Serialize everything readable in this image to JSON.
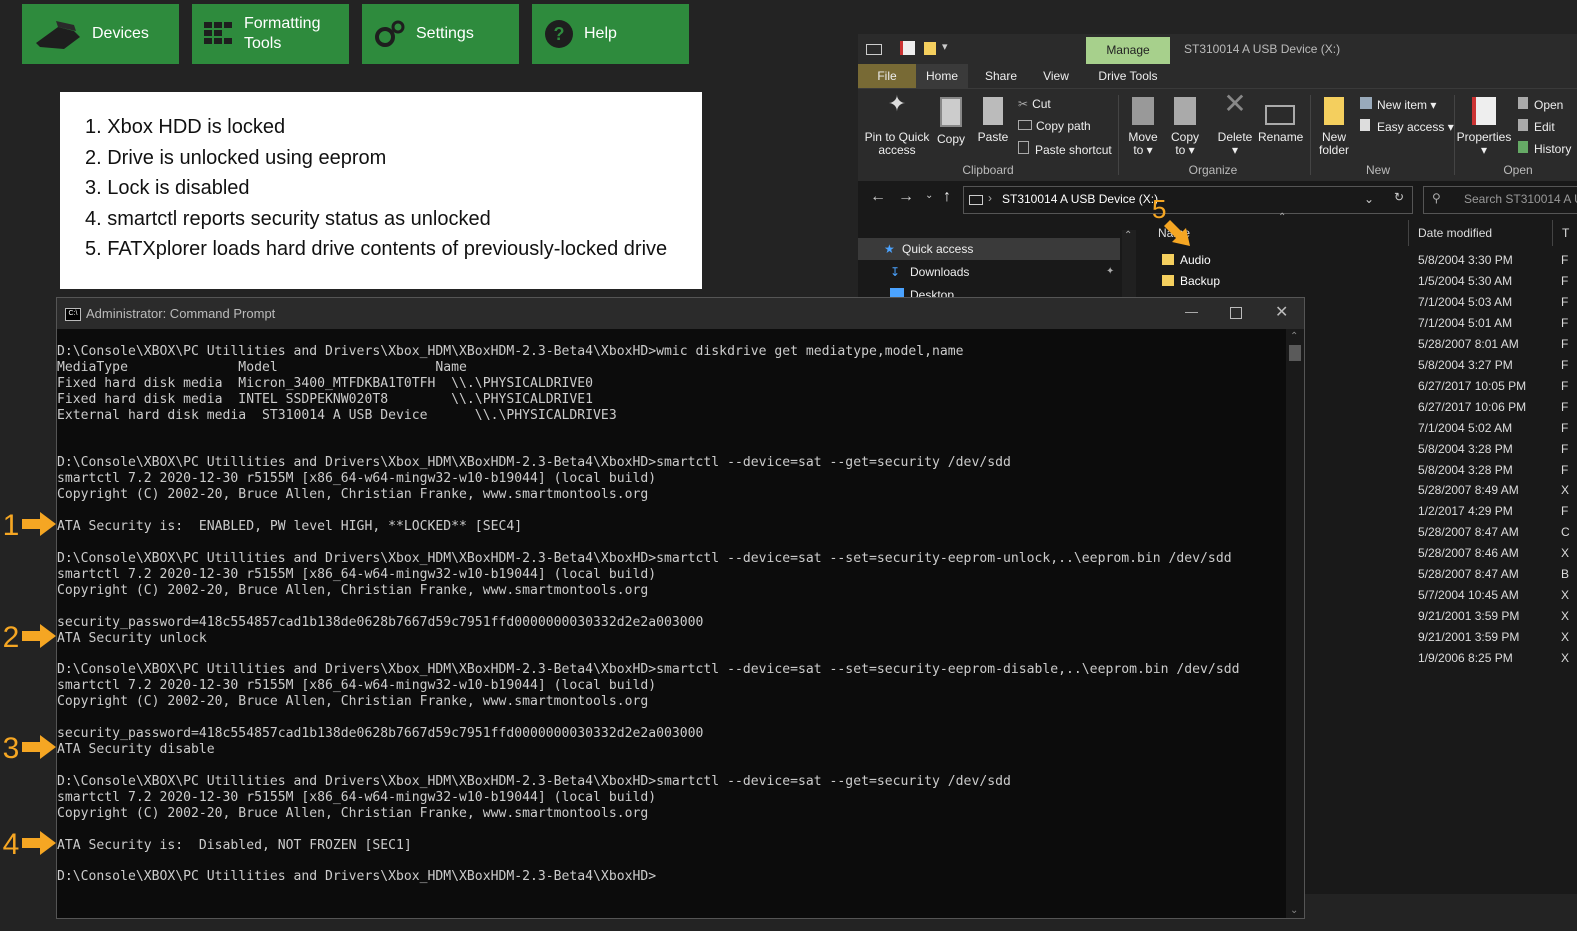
{
  "toolbar": {
    "devices": "Devices",
    "formatting_line1": "Formatting",
    "formatting_line2": "Tools",
    "settings": "Settings",
    "help": "Help"
  },
  "steps": [
    "1. Xbox HDD is locked",
    "2. Drive is unlocked using eeprom",
    "3. Lock is disabled",
    "4. smartctl reports security status as unlocked",
    "5. FATXplorer loads hard drive contents of previously-locked drive"
  ],
  "markers": [
    "1",
    "2",
    "3",
    "4",
    "5"
  ],
  "explorer": {
    "manage_tab": "Manage",
    "window_title": "ST310014 A USB Device (X:)",
    "tabs": [
      "File",
      "Home",
      "Share",
      "View",
      "Drive Tools"
    ],
    "ribbon": {
      "pin_line1": "Pin to Quick",
      "pin_line2": "access",
      "copy": "Copy",
      "paste": "Paste",
      "cut": "Cut",
      "copy_path": "Copy path",
      "paste_shortcut": "Paste shortcut",
      "clipboard": "Clipboard",
      "move_line1": "Move",
      "move_line2": "to",
      "copyto_line1": "Copy",
      "copyto_line2": "to",
      "delete": "Delete",
      "rename": "Rename",
      "organize": "Organize",
      "new_folder_line1": "New",
      "new_folder_line2": "folder",
      "new_item": "New item",
      "easy_access": "Easy access",
      "new": "New",
      "properties": "Properties",
      "open": "Open",
      "edit": "Edit",
      "history": "History",
      "open_group": "Open"
    },
    "address": "ST310014 A USB Device (X:)",
    "search_placeholder": "Search ST310014 A U",
    "nav": [
      "Quick access",
      "Downloads",
      "Desktop"
    ],
    "columns": {
      "name": "Name",
      "date": "Date modified",
      "type": "T"
    },
    "files": [
      {
        "name": "Audio",
        "date": "5/8/2004 3:30 PM",
        "type": "F"
      },
      {
        "name": "Backup",
        "date": "1/5/2004 5:30 AM",
        "type": "F"
      },
      {
        "name": "",
        "date": "7/1/2004 5:03 AM",
        "type": "F"
      },
      {
        "name": "",
        "date": "7/1/2004 5:01 AM",
        "type": "F"
      },
      {
        "name": "",
        "date": "5/28/2007 8:01 AM",
        "type": "F"
      },
      {
        "name": "",
        "date": "5/8/2004 3:27 PM",
        "type": "F"
      },
      {
        "name": "",
        "date": "6/27/2017 10:05 PM",
        "type": "F"
      },
      {
        "name": "",
        "date": "6/27/2017 10:06 PM",
        "type": "F"
      },
      {
        "name": "",
        "date": "7/1/2004 5:02 AM",
        "type": "F"
      },
      {
        "name": "",
        "date": "5/8/2004 3:28 PM",
        "type": "F"
      },
      {
        "name": "",
        "date": "5/8/2004 3:28 PM",
        "type": "F"
      },
      {
        "name": "",
        "date": "5/28/2007 8:49 AM",
        "type": "X"
      },
      {
        "name": "",
        "date": "1/2/2017 4:29 PM",
        "type": "F"
      },
      {
        "name": "",
        "date": "5/28/2007 8:47 AM",
        "type": "C"
      },
      {
        "name": "",
        "date": "5/28/2007 8:46 AM",
        "type": "X"
      },
      {
        "name": "",
        "date": "5/28/2007 8:47 AM",
        "type": "B"
      },
      {
        "name": "",
        "date": "5/7/2004 10:45 AM",
        "type": "X"
      },
      {
        "name": "",
        "date": "9/21/2001 3:59 PM",
        "type": "X"
      },
      {
        "name": "",
        "date": "9/21/2001 3:59 PM",
        "type": "X"
      },
      {
        "name": "",
        "date": "1/9/2006 8:25 PM",
        "type": "X"
      }
    ]
  },
  "cmd": {
    "title": "Administrator: Command Prompt",
    "lines": [
      "D:\\Console\\XBOX\\PC Utillities and Drivers\\Xbox_HDM\\XBoxHDM-2.3-Beta4\\XboxHD>wmic diskdrive get mediatype,model,name",
      "MediaType              Model                    Name",
      "Fixed hard disk media  Micron_3400_MTFDKBA1T0TFH  \\\\.\\PHYSICALDRIVE0",
      "Fixed hard disk media  INTEL SSDPEKNW020T8        \\\\.\\PHYSICALDRIVE1",
      "External hard disk media  ST310014 A USB Device      \\\\.\\PHYSICALDRIVE3",
      "",
      "",
      "D:\\Console\\XBOX\\PC Utillities and Drivers\\Xbox_HDM\\XBoxHDM-2.3-Beta4\\XboxHD>smartctl --device=sat --get=security /dev/sdd",
      "smartctl 7.2 2020-12-30 r5155M [x86_64-w64-mingw32-w10-b19044] (local build)",
      "Copyright (C) 2002-20, Bruce Allen, Christian Franke, www.smartmontools.org",
      "",
      "ATA Security is:  ENABLED, PW level HIGH, **LOCKED** [SEC4]",
      "",
      "D:\\Console\\XBOX\\PC Utillities and Drivers\\Xbox_HDM\\XBoxHDM-2.3-Beta4\\XboxHD>smartctl --device=sat --set=security-eeprom-unlock,..\\eeprom.bin /dev/sdd",
      "smartctl 7.2 2020-12-30 r5155M [x86_64-w64-mingw32-w10-b19044] (local build)",
      "Copyright (C) 2002-20, Bruce Allen, Christian Franke, www.smartmontools.org",
      "",
      "security_password=418c554857cad1b138de0628b7667d59c7951ffd0000000030332d2e2a003000",
      "ATA Security unlock",
      "",
      "D:\\Console\\XBOX\\PC Utillities and Drivers\\Xbox_HDM\\XBoxHDM-2.3-Beta4\\XboxHD>smartctl --device=sat --set=security-eeprom-disable,..\\eeprom.bin /dev/sdd",
      "smartctl 7.2 2020-12-30 r5155M [x86_64-w64-mingw32-w10-b19044] (local build)",
      "Copyright (C) 2002-20, Bruce Allen, Christian Franke, www.smartmontools.org",
      "",
      "security_password=418c554857cad1b138de0628b7667d59c7951ffd0000000030332d2e2a003000",
      "ATA Security disable",
      "",
      "D:\\Console\\XBOX\\PC Utillities and Drivers\\Xbox_HDM\\XBoxHDM-2.3-Beta4\\XboxHD>smartctl --device=sat --get=security /dev/sdd",
      "smartctl 7.2 2020-12-30 r5155M [x86_64-w64-mingw32-w10-b19044] (local build)",
      "Copyright (C) 2002-20, Bruce Allen, Christian Franke, www.smartmontools.org",
      "",
      "ATA Security is:  Disabled, NOT FROZEN [SEC1]",
      "",
      "D:\\Console\\XBOX\\PC Utillities and Drivers\\Xbox_HDM\\XBoxHDM-2.3-Beta4\\XboxHD>"
    ]
  },
  "colors": {
    "green": "#2e8b3d",
    "marker": "#f5a623",
    "manage": "#a7d08c",
    "file_tab": "#786a35",
    "folder": "#f4cf5e"
  }
}
